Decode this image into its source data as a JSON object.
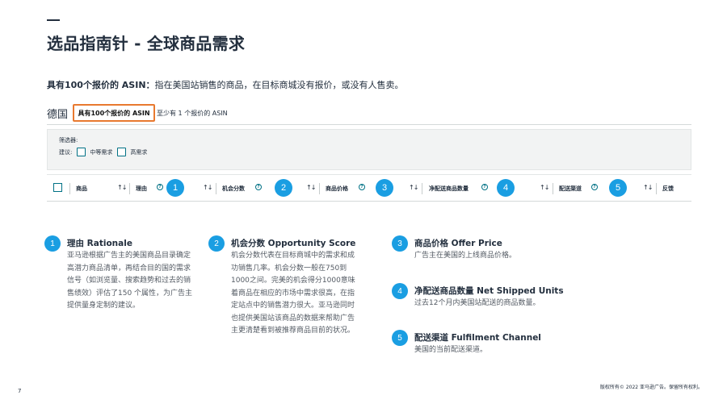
{
  "slide": {
    "title": "选品指南针 - 全球商品需求",
    "intro_bold": "具有100个报价的 ASIN：",
    "intro_text": "指在美国站销售的商品，在目标商城没有报价，或没有人售卖。",
    "page_number": "7",
    "copyright": "版权所有© 2022 亚马逊广告。保留所有权利。"
  },
  "tabs": {
    "country": "德国",
    "active": "具有100个报价的 ASIN",
    "other": "至少有 1 个报价的 ASIN"
  },
  "filters": {
    "title": "筛选器:",
    "label": "建议:",
    "option1": "中等需求",
    "option2": "高需求"
  },
  "table": {
    "columns": [
      "商品",
      "理由",
      "机会分数",
      "商品价格",
      "净配送商品数量",
      "配送渠道",
      "反馈"
    ],
    "info_glyph": "?",
    "sort_glyph": "↑↓",
    "badges": [
      "1",
      "2",
      "3",
      "4",
      "5"
    ]
  },
  "notes": [
    {
      "num": "1",
      "title": "理由 Rationale",
      "body": "亚马逊根据广告主的美国商品目录确定高潜力商品清单，再结合目的国的需求信号（如浏览量、搜索趋势和过去的销售绩效）评估了150 个属性，为广告主提供量身定制的建议。"
    },
    {
      "num": "2",
      "title": "机会分数 Opportunity Score",
      "body": "机会分数代表在目标商城中的需求和成功销售几率。机会分数一般在750到1000之间。完美的机会得分1000意味着商品在相应的市场中需求很高，在指定站点中的销售潜力很大。亚马逊同时也提供美国站该商品的数据来帮助广告主更清楚看到被推荐商品目前的状况。"
    },
    {
      "num": "3",
      "title": "商品价格 Offer Price",
      "body": "广告主在美国的上线商品价格。"
    },
    {
      "num": "4",
      "title": "净配送商品数量 Net Shipped Units",
      "body": "过去12个月内美国站配送的商品数量。"
    },
    {
      "num": "5",
      "title": "配送渠道 Fulfilment Channel",
      "body": "美国的当前配送渠道。"
    }
  ],
  "colors": {
    "accent": "#1a9ee2",
    "highlight": "#e8792f",
    "text": "#232f3e",
    "teal": "#007185"
  }
}
